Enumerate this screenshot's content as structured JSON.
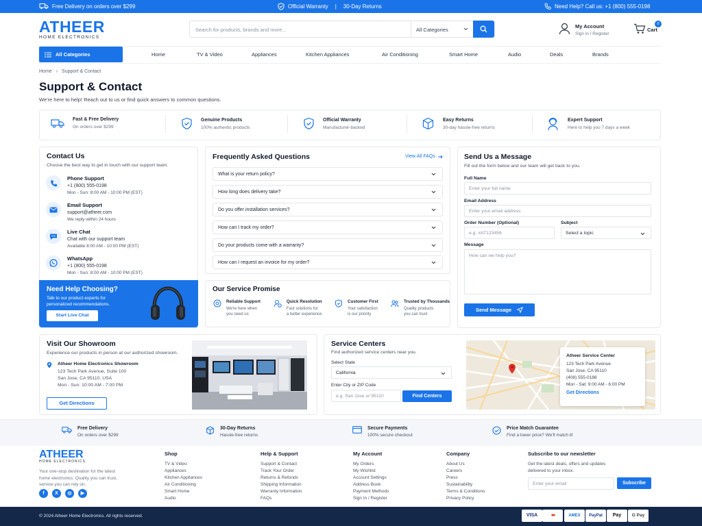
{
  "topbar": {
    "delivery": "Free Delivery on orders over $299",
    "warranty": "Official Warranty",
    "divider": "|",
    "returns": "30-Day Returns",
    "help": "Need Help? Call us: +1 (800) 555-0198"
  },
  "header": {
    "logo_main": "ATHEER",
    "logo_sub": "HOME ELECTRONICS",
    "search_placeholder": "Search for products, brands and more...",
    "search_category": "All Categories",
    "account_title": "My Account",
    "account_sub": "Sign in / Register",
    "cart_label": "Cart",
    "cart_count": "0"
  },
  "nav": {
    "all_categories": "All Categories",
    "items": [
      "Home",
      "TV & Video",
      "Appliances",
      "Kitchen Appliances",
      "Air Conditioning",
      "Smart Home",
      "Audio",
      "Deals",
      "Brands"
    ]
  },
  "breadcrumb": {
    "home": "Home",
    "sep": "›",
    "current": "Support & Contact"
  },
  "page": {
    "title": "Support & Contact",
    "subtitle": "We're here to help! Reach out to us or find quick answers to common questions."
  },
  "features": [
    {
      "title": "Fast & Free Delivery",
      "sub": "On orders over $299",
      "icon": "truck-icon"
    },
    {
      "title": "Genuine Products",
      "sub": "100% authentic products",
      "icon": "shield-check-icon"
    },
    {
      "title": "Official Warranty",
      "sub": "Manufacturer-backed",
      "icon": "shield-check-icon"
    },
    {
      "title": "Easy Returns",
      "sub": "30-day hassle-free returns",
      "icon": "box-icon"
    },
    {
      "title": "Expert Support",
      "sub": "Here to help you 7 days a week",
      "icon": "support-agent-icon"
    }
  ],
  "contact": {
    "title": "Contact Us",
    "subtitle": "Choose the best way to get in touch with our support team.",
    "items": [
      {
        "title": "Phone Support",
        "line1": "+1 (800) 555-0198",
        "line2": "Mon - Sun: 8:00 AM - 10:00 PM (EST)",
        "icon": "phone-icon"
      },
      {
        "title": "Email Support",
        "line1": "support@atheer.com",
        "line2": "We reply within 24 hours",
        "icon": "mail-icon"
      },
      {
        "title": "Live Chat",
        "line1": "Chat with our support team",
        "line2": "Available 8:00 AM - 10:00 PM (EST)",
        "icon": "chat-icon"
      },
      {
        "title": "WhatsApp",
        "line1": "+1 (800) 555-0198",
        "line2": "Mon - Sun: 8:00 AM - 10:00 PM (EST)",
        "icon": "whatsapp-icon"
      }
    ],
    "help_title": "Need Help Choosing?",
    "help_sub": "Talk to our product experts for personalized recommendations.",
    "help_button": "Start Live Chat"
  },
  "faq": {
    "title": "Frequently Asked Questions",
    "view_all": "View All FAQs",
    "questions": [
      "What is your return policy?",
      "How long does delivery take?",
      "Do you offer installation services?",
      "How can I track my order?",
      "Do your products come with a warranty?",
      "How can I request an invoice for my order?"
    ]
  },
  "promise": {
    "title": "Our Service Promise",
    "items": [
      {
        "title": "Reliable Support",
        "sub1": "We're here when",
        "sub2": "you need us"
      },
      {
        "title": "Quick Resolution",
        "sub1": "Fast solutions for",
        "sub2": "a better experience"
      },
      {
        "title": "Customer First",
        "sub1": "Your satisfaction",
        "sub2": "is our priority"
      },
      {
        "title": "Trusted by Thousands",
        "sub1": "Quality products",
        "sub2": "you can trust"
      }
    ]
  },
  "message_form": {
    "title": "Send Us a Message",
    "subtitle": "Fill out the form below and our team will get back to you.",
    "full_name_label": "Full Name",
    "full_name_placeholder": "Enter your full name",
    "email_label": "Email Address",
    "email_placeholder": "Enter your email address",
    "order_label": "Order Number (Optional)",
    "order_placeholder": "e.g. #AT123456",
    "subject_label": "Subject",
    "subject_placeholder": "Select a topic",
    "message_label": "Message",
    "message_placeholder": "How can we help you?",
    "send_button": "Send Message"
  },
  "showroom": {
    "title": "Visit Our Showroom",
    "subtitle": "Experience our products in person at our authorized showroom.",
    "name": "Atheer Home Electronics Showroom",
    "addr1": "123 Tech Park Avenue, Suite 100",
    "addr2": "San Jose, CA 95110, USA",
    "hours": "Mon - Sun: 10:00 AM - 7:00 PM",
    "button": "Get Directions"
  },
  "service_centers": {
    "title": "Service Centers",
    "subtitle": "Find authorized service centers near you.",
    "state_label": "Select State",
    "state_value": "California",
    "city_label": "Enter City or ZIP Code",
    "city_placeholder": "e.g. San Jose or 95110",
    "button": "Find Centers",
    "card_title": "Atheer Service Center",
    "card_addr1": "123 Tech Park Avenue",
    "card_addr2": "San Jose, CA 95110",
    "card_phone": "(408) 555-0188",
    "card_hours": "Mon - Sat: 9:00 AM - 6:00 PM",
    "card_link": "Get Directions"
  },
  "band": [
    {
      "title": "Free Delivery",
      "sub": "On orders over $299",
      "icon": "truck-icon"
    },
    {
      "title": "30-Day Returns",
      "sub": "Hassle-free returns",
      "icon": "box-icon"
    },
    {
      "title": "Secure Payments",
      "sub": "100% secure checkout",
      "icon": "card-icon"
    },
    {
      "title": "Price Match Guarantee",
      "sub": "Find a lower price? We'll match it!",
      "icon": "badge-icon"
    }
  ],
  "footer": {
    "logo_main": "ATHEER",
    "logo_sub": "HOME ELECTRONICS",
    "about1": "Your one-stop destination for the latest",
    "about2": "home electronics. Quality you can trust,",
    "about3": "service you can rely on.",
    "columns": [
      {
        "title": "Shop",
        "links": [
          "TV & Video",
          "Appliances",
          "Kitchen Appliances",
          "Air Conditioning",
          "Smart Home",
          "Audio"
        ]
      },
      {
        "title": "Help & Support",
        "links": [
          "Support & Contact",
          "Track Your Order",
          "Returns & Refunds",
          "Shipping Information",
          "Warranty Information",
          "FAQs"
        ]
      },
      {
        "title": "My Account",
        "links": [
          "My Orders",
          "My Wishlist",
          "Account Settings",
          "Address Book",
          "Payment Methods",
          "Sign In / Register"
        ]
      },
      {
        "title": "Company",
        "links": [
          "About Us",
          "Careers",
          "Press",
          "Sustainability",
          "Terms & Conditions",
          "Privacy Policy"
        ]
      }
    ],
    "newsletter_title": "Subscribe to our newsletter",
    "newsletter_sub1": "Get the latest deals, offers and updates",
    "newsletter_sub2": "delivered to your inbox.",
    "newsletter_placeholder": "Enter your email",
    "newsletter_button": "Subscribe",
    "social": [
      "f",
      "X",
      "◎",
      "▶"
    ],
    "copyright": "© 2024 Atheer Home Electronics. All rights reserved.",
    "payments": [
      "VISA",
      "●●",
      "AMEX",
      "PayPal",
      "Pay",
      "G Pay"
    ]
  },
  "colors": {
    "primary": "#1a74e8",
    "footer_dark": "#14284a"
  }
}
